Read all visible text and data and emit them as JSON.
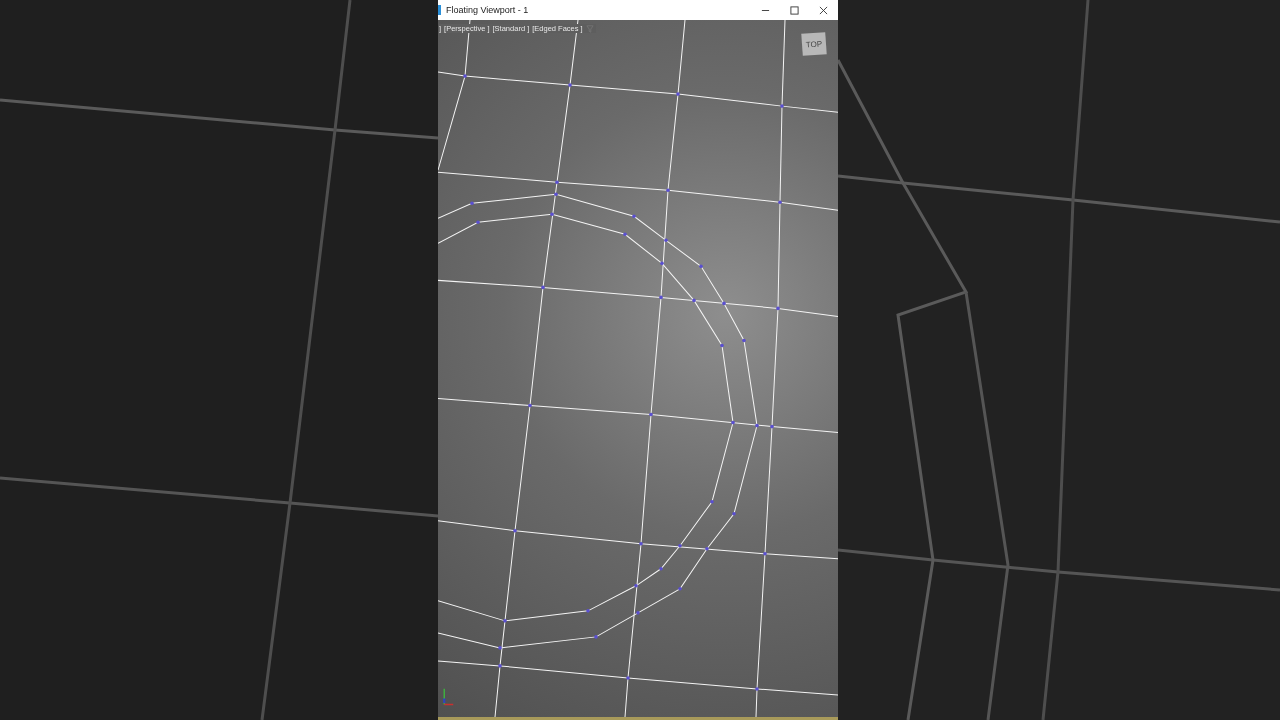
{
  "window": {
    "title": "Floating Viewport - 1"
  },
  "viewport": {
    "labels": [
      "]",
      "[Perspective ]",
      "[Standard ]",
      "[Edged Faces ]"
    ],
    "viewcube": "TOP"
  }
}
